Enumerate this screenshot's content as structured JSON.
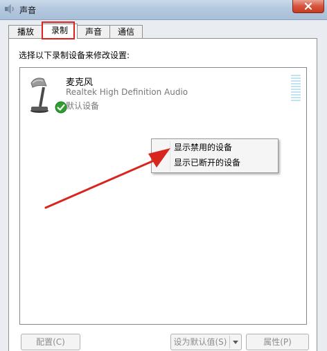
{
  "window": {
    "title": "声音",
    "icon": "speaker-icon",
    "close_icon": "close-icon"
  },
  "tabs": [
    {
      "label": "播放",
      "active": false
    },
    {
      "label": "录制",
      "active": true
    },
    {
      "label": "声音",
      "active": false
    },
    {
      "label": "通信",
      "active": false
    }
  ],
  "recording": {
    "instruction": "选择以下录制设备来修改设置:",
    "devices": [
      {
        "name": "麦克风",
        "description": "Realtek High Definition Audio",
        "status": "默认设备",
        "icon": "microphone-icon",
        "badge_icon": "checkmark-icon"
      }
    ]
  },
  "context_menu": {
    "items": [
      {
        "label": "显示禁用的设备"
      },
      {
        "label": "显示已断开的设备"
      }
    ]
  },
  "buttons": {
    "configure": "配置(C)",
    "set_default": "设为默认值(S)",
    "properties": "属性(P)"
  },
  "colors": {
    "highlight": "#e0201c",
    "arrow": "#d7261e"
  }
}
